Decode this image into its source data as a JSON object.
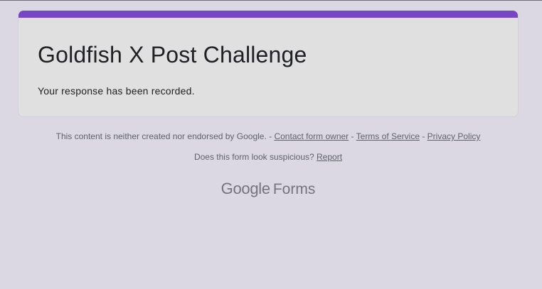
{
  "form": {
    "title": "Goldfish X Post Challenge",
    "confirmation": "Your response has been recorded.",
    "accent_color": "#7845c6"
  },
  "footer": {
    "disclaimer_text": "This content is neither created nor endorsed by Google. - ",
    "contact_link": "Contact form owner",
    "sep1": " - ",
    "terms_link": "Terms of Service",
    "sep2": " - ",
    "privacy_link": "Privacy Policy",
    "suspicious_text": "Does this form look suspicious? ",
    "report_link": "Report"
  },
  "brand": {
    "google": "Google",
    "forms": "Forms"
  }
}
